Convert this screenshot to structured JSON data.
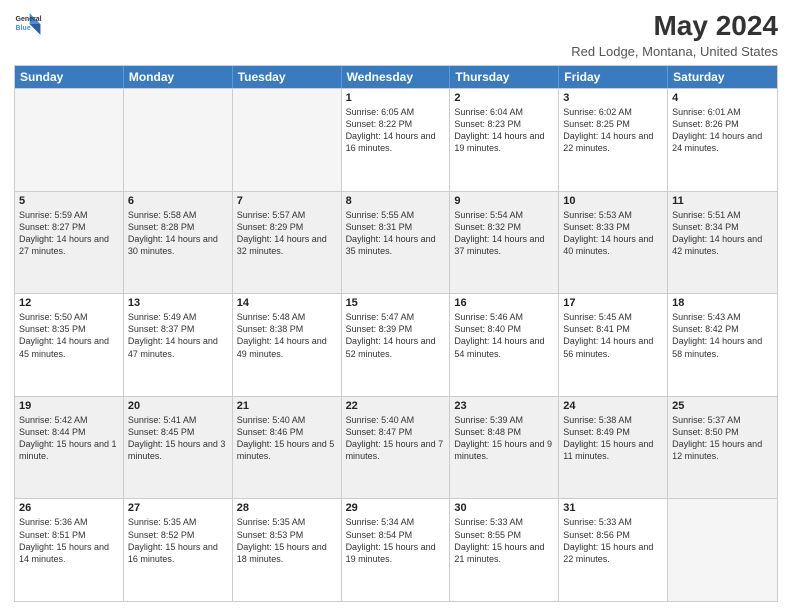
{
  "logo": {
    "line1": "General",
    "line2": "Blue"
  },
  "title": "May 2024",
  "subtitle": "Red Lodge, Montana, United States",
  "days_of_week": [
    "Sunday",
    "Monday",
    "Tuesday",
    "Wednesday",
    "Thursday",
    "Friday",
    "Saturday"
  ],
  "weeks": [
    [
      {
        "day": "",
        "info": "",
        "empty": true
      },
      {
        "day": "",
        "info": "",
        "empty": true
      },
      {
        "day": "",
        "info": "",
        "empty": true
      },
      {
        "day": "1",
        "info": "Sunrise: 6:05 AM\nSunset: 8:22 PM\nDaylight: 14 hours\nand 16 minutes."
      },
      {
        "day": "2",
        "info": "Sunrise: 6:04 AM\nSunset: 8:23 PM\nDaylight: 14 hours\nand 19 minutes."
      },
      {
        "day": "3",
        "info": "Sunrise: 6:02 AM\nSunset: 8:25 PM\nDaylight: 14 hours\nand 22 minutes."
      },
      {
        "day": "4",
        "info": "Sunrise: 6:01 AM\nSunset: 8:26 PM\nDaylight: 14 hours\nand 24 minutes."
      }
    ],
    [
      {
        "day": "5",
        "info": "Sunrise: 5:59 AM\nSunset: 8:27 PM\nDaylight: 14 hours\nand 27 minutes."
      },
      {
        "day": "6",
        "info": "Sunrise: 5:58 AM\nSunset: 8:28 PM\nDaylight: 14 hours\nand 30 minutes."
      },
      {
        "day": "7",
        "info": "Sunrise: 5:57 AM\nSunset: 8:29 PM\nDaylight: 14 hours\nand 32 minutes."
      },
      {
        "day": "8",
        "info": "Sunrise: 5:55 AM\nSunset: 8:31 PM\nDaylight: 14 hours\nand 35 minutes."
      },
      {
        "day": "9",
        "info": "Sunrise: 5:54 AM\nSunset: 8:32 PM\nDaylight: 14 hours\nand 37 minutes."
      },
      {
        "day": "10",
        "info": "Sunrise: 5:53 AM\nSunset: 8:33 PM\nDaylight: 14 hours\nand 40 minutes."
      },
      {
        "day": "11",
        "info": "Sunrise: 5:51 AM\nSunset: 8:34 PM\nDaylight: 14 hours\nand 42 minutes."
      }
    ],
    [
      {
        "day": "12",
        "info": "Sunrise: 5:50 AM\nSunset: 8:35 PM\nDaylight: 14 hours\nand 45 minutes."
      },
      {
        "day": "13",
        "info": "Sunrise: 5:49 AM\nSunset: 8:37 PM\nDaylight: 14 hours\nand 47 minutes."
      },
      {
        "day": "14",
        "info": "Sunrise: 5:48 AM\nSunset: 8:38 PM\nDaylight: 14 hours\nand 49 minutes."
      },
      {
        "day": "15",
        "info": "Sunrise: 5:47 AM\nSunset: 8:39 PM\nDaylight: 14 hours\nand 52 minutes."
      },
      {
        "day": "16",
        "info": "Sunrise: 5:46 AM\nSunset: 8:40 PM\nDaylight: 14 hours\nand 54 minutes."
      },
      {
        "day": "17",
        "info": "Sunrise: 5:45 AM\nSunset: 8:41 PM\nDaylight: 14 hours\nand 56 minutes."
      },
      {
        "day": "18",
        "info": "Sunrise: 5:43 AM\nSunset: 8:42 PM\nDaylight: 14 hours\nand 58 minutes."
      }
    ],
    [
      {
        "day": "19",
        "info": "Sunrise: 5:42 AM\nSunset: 8:44 PM\nDaylight: 15 hours\nand 1 minute."
      },
      {
        "day": "20",
        "info": "Sunrise: 5:41 AM\nSunset: 8:45 PM\nDaylight: 15 hours\nand 3 minutes."
      },
      {
        "day": "21",
        "info": "Sunrise: 5:40 AM\nSunset: 8:46 PM\nDaylight: 15 hours\nand 5 minutes."
      },
      {
        "day": "22",
        "info": "Sunrise: 5:40 AM\nSunset: 8:47 PM\nDaylight: 15 hours\nand 7 minutes."
      },
      {
        "day": "23",
        "info": "Sunrise: 5:39 AM\nSunset: 8:48 PM\nDaylight: 15 hours\nand 9 minutes."
      },
      {
        "day": "24",
        "info": "Sunrise: 5:38 AM\nSunset: 8:49 PM\nDaylight: 15 hours\nand 11 minutes."
      },
      {
        "day": "25",
        "info": "Sunrise: 5:37 AM\nSunset: 8:50 PM\nDaylight: 15 hours\nand 12 minutes."
      }
    ],
    [
      {
        "day": "26",
        "info": "Sunrise: 5:36 AM\nSunset: 8:51 PM\nDaylight: 15 hours\nand 14 minutes."
      },
      {
        "day": "27",
        "info": "Sunrise: 5:35 AM\nSunset: 8:52 PM\nDaylight: 15 hours\nand 16 minutes."
      },
      {
        "day": "28",
        "info": "Sunrise: 5:35 AM\nSunset: 8:53 PM\nDaylight: 15 hours\nand 18 minutes."
      },
      {
        "day": "29",
        "info": "Sunrise: 5:34 AM\nSunset: 8:54 PM\nDaylight: 15 hours\nand 19 minutes."
      },
      {
        "day": "30",
        "info": "Sunrise: 5:33 AM\nSunset: 8:55 PM\nDaylight: 15 hours\nand 21 minutes."
      },
      {
        "day": "31",
        "info": "Sunrise: 5:33 AM\nSunset: 8:56 PM\nDaylight: 15 hours\nand 22 minutes."
      },
      {
        "day": "",
        "info": "",
        "empty": true
      }
    ]
  ]
}
